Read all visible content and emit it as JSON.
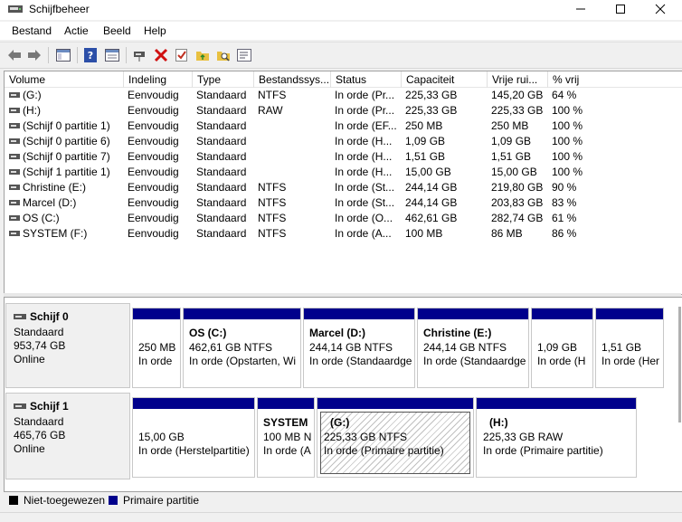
{
  "window": {
    "title": "Schijfbeheer"
  },
  "menu": [
    "Bestand",
    "Actie",
    "Beeld",
    "Help"
  ],
  "columns": [
    "Volume",
    "Indeling",
    "Type",
    "Bestandssys...",
    "Status",
    "Capaciteit",
    "Vrije rui...",
    "% vrij"
  ],
  "volumes": [
    [
      "(G:)",
      "Eenvoudig",
      "Standaard",
      "NTFS",
      "In orde (Pr...",
      "225,33 GB",
      "145,20 GB",
      "64 %"
    ],
    [
      "(H:)",
      "Eenvoudig",
      "Standaard",
      "RAW",
      "In orde (Pr...",
      "225,33 GB",
      "225,33 GB",
      "100 %"
    ],
    [
      "(Schijf 0 partitie 1)",
      "Eenvoudig",
      "Standaard",
      "",
      "In orde (EF...",
      "250 MB",
      "250 MB",
      "100 %"
    ],
    [
      "(Schijf 0 partitie 6)",
      "Eenvoudig",
      "Standaard",
      "",
      "In orde (H...",
      "1,09 GB",
      "1,09 GB",
      "100 %"
    ],
    [
      "(Schijf 0 partitie 7)",
      "Eenvoudig",
      "Standaard",
      "",
      "In orde (H...",
      "1,51 GB",
      "1,51 GB",
      "100 %"
    ],
    [
      "(Schijf 1 partitie 1)",
      "Eenvoudig",
      "Standaard",
      "",
      "In orde (H...",
      "15,00 GB",
      "15,00 GB",
      "100 %"
    ],
    [
      "Christine (E:)",
      "Eenvoudig",
      "Standaard",
      "NTFS",
      "In orde (St...",
      "244,14 GB",
      "219,80 GB",
      "90 %"
    ],
    [
      "Marcel (D:)",
      "Eenvoudig",
      "Standaard",
      "NTFS",
      "In orde (St...",
      "244,14 GB",
      "203,83 GB",
      "83 %"
    ],
    [
      "OS (C:)",
      "Eenvoudig",
      "Standaard",
      "NTFS",
      "In orde (O...",
      "462,61 GB",
      "282,74 GB",
      "61 %"
    ],
    [
      "SYSTEM (F:)",
      "Eenvoudig",
      "Standaard",
      "NTFS",
      "In orde (A...",
      "100 MB",
      "86 MB",
      "86 %"
    ]
  ],
  "disks": [
    {
      "name": "Schijf 0",
      "type": "Standaard",
      "size": "953,74 GB",
      "state": "Online",
      "partitions": [
        {
          "name": "",
          "size": "250 MB",
          "status": "In orde"
        },
        {
          "name": "OS  (C:)",
          "size": "462,61 GB NTFS",
          "status": "In orde (Opstarten, Wi"
        },
        {
          "name": "Marcel  (D:)",
          "size": "244,14 GB NTFS",
          "status": "In orde (Standaardge"
        },
        {
          "name": "Christine  (E:)",
          "size": "244,14 GB NTFS",
          "status": "In orde (Standaardge"
        },
        {
          "name": "",
          "size": "1,09 GB",
          "status": "In orde (H"
        },
        {
          "name": "",
          "size": "1,51 GB",
          "status": "In orde (Her"
        }
      ]
    },
    {
      "name": "Schijf 1",
      "type": "Standaard",
      "size": "465,76 GB",
      "state": "Online",
      "partitions": [
        {
          "name": "",
          "size": "15,00 GB",
          "status": "In orde (Herstelpartitie)"
        },
        {
          "name": "SYSTEM",
          "size": "100 MB N",
          "status": "In orde (A"
        },
        {
          "name": "(G:)",
          "size": "225,33 GB NTFS",
          "status": "In orde (Primaire partitie)"
        },
        {
          "name": "(H:)",
          "size": "225,33 GB RAW",
          "status": "In orde (Primaire partitie)"
        }
      ]
    }
  ],
  "legend": {
    "unallocated": "Niet-toegewezen",
    "primary": "Primaire partitie"
  },
  "colors": {
    "unallocated": "#000000",
    "primary": "#00008c",
    "selection": "#0078d7"
  }
}
